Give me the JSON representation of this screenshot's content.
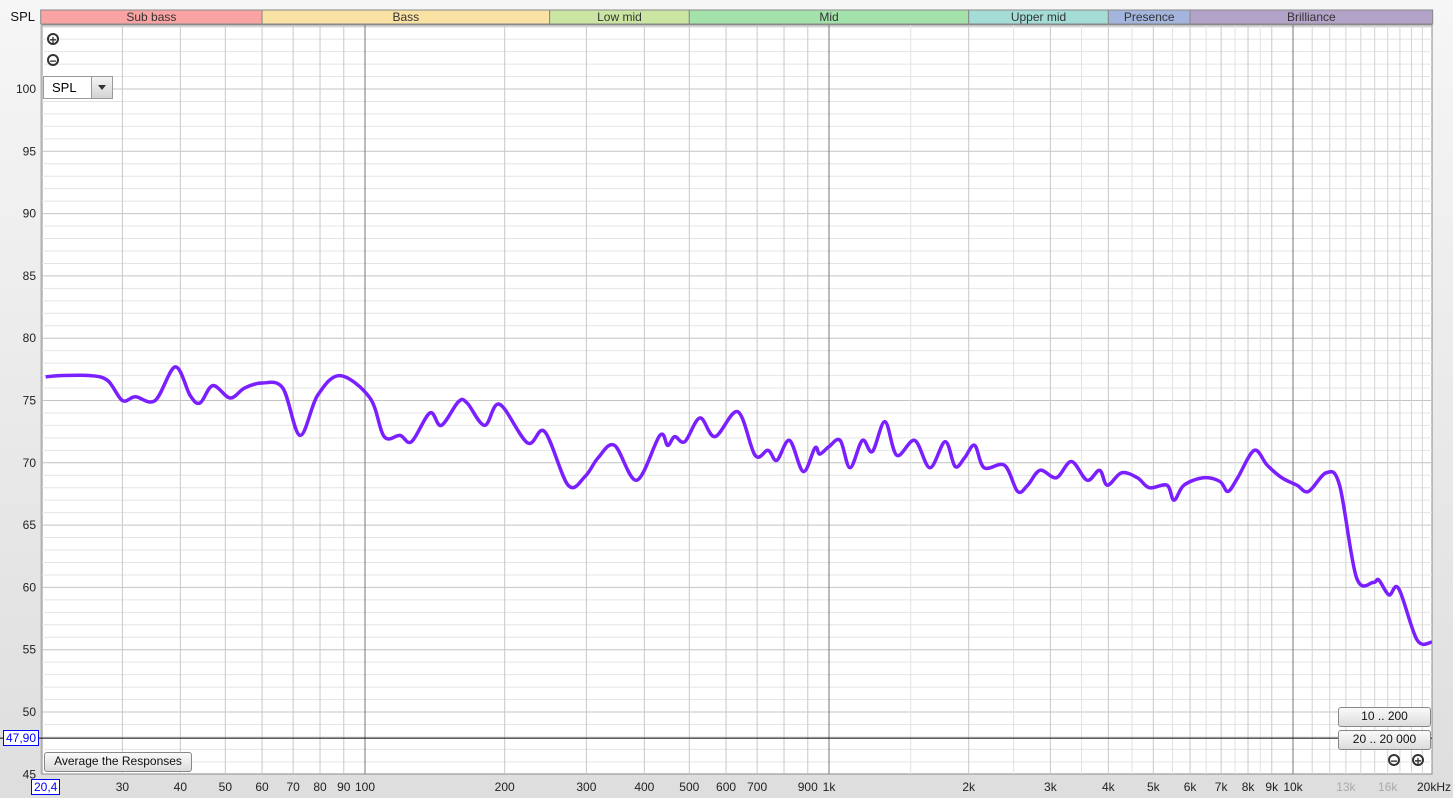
{
  "chart_data": {
    "type": "line",
    "ylabel": "SPL",
    "xunit": "kHz",
    "xscale": "log",
    "xlim": [
      20,
      20000
    ],
    "ylim": [
      45,
      105
    ],
    "grid": true,
    "line_color": "#7b1fff",
    "y_ticks": [
      45,
      50,
      55,
      60,
      65,
      70,
      75,
      80,
      85,
      90,
      95,
      100
    ],
    "x_ticks": [
      {
        "v": 30,
        "label": "30"
      },
      {
        "v": 40,
        "label": "40"
      },
      {
        "v": 50,
        "label": "50"
      },
      {
        "v": 60,
        "label": "60"
      },
      {
        "v": 70,
        "label": "70"
      },
      {
        "v": 80,
        "label": "80"
      },
      {
        "v": 90,
        "label": "90"
      },
      {
        "v": 100,
        "label": "100"
      },
      {
        "v": 200,
        "label": "200"
      },
      {
        "v": 300,
        "label": "300"
      },
      {
        "v": 400,
        "label": "400"
      },
      {
        "v": 500,
        "label": "500"
      },
      {
        "v": 600,
        "label": "600"
      },
      {
        "v": 700,
        "label": "700"
      },
      {
        "v": 900,
        "label": "900"
      },
      {
        "v": 1000,
        "label": "1k"
      },
      {
        "v": 2000,
        "label": "2k"
      },
      {
        "v": 3000,
        "label": "3k"
      },
      {
        "v": 4000,
        "label": "4k"
      },
      {
        "v": 5000,
        "label": "5k"
      },
      {
        "v": 6000,
        "label": "6k"
      },
      {
        "v": 7000,
        "label": "7k"
      },
      {
        "v": 8000,
        "label": "8k"
      },
      {
        "v": 9000,
        "label": "9k"
      },
      {
        "v": 10000,
        "label": "10k"
      },
      {
        "v": 13000,
        "label": "13k",
        "dim": true
      },
      {
        "v": 16000,
        "label": "16k",
        "dim": true
      },
      {
        "v": 20000,
        "label": "20kHz"
      }
    ],
    "bands": [
      {
        "label": "Sub bass",
        "from": 20,
        "to": 60,
        "color": "#f9a3a3"
      },
      {
        "label": "Bass",
        "from": 60,
        "to": 250,
        "color": "#f9e2a3"
      },
      {
        "label": "Low mid",
        "from": 250,
        "to": 500,
        "color": "#cbe6a3"
      },
      {
        "label": "Mid",
        "from": 500,
        "to": 2000,
        "color": "#a3e2aa"
      },
      {
        "label": "Upper mid",
        "from": 2000,
        "to": 4000,
        "color": "#a3ddd6"
      },
      {
        "label": "Presence",
        "from": 4000,
        "to": 6000,
        "color": "#a3b5dd"
      },
      {
        "label": "Brilliance",
        "from": 6000,
        "to": 20000,
        "color": "#b3a3c8"
      }
    ],
    "cursor": {
      "freq_label": "20,4",
      "spl_label": "47,90",
      "spl": 47.9
    },
    "points": [
      [
        20.5,
        76.9
      ],
      [
        22,
        77.0
      ],
      [
        25.6,
        77.0
      ],
      [
        27.9,
        76.6
      ],
      [
        30,
        75.0
      ],
      [
        32,
        75.3
      ],
      [
        35.3,
        75.0
      ],
      [
        39,
        77.7
      ],
      [
        42,
        75.4
      ],
      [
        44.1,
        74.8
      ],
      [
        47,
        76.2
      ],
      [
        51.2,
        75.2
      ],
      [
        55,
        76.0
      ],
      [
        60,
        76.4
      ],
      [
        66.5,
        76.0
      ],
      [
        72.4,
        72.2
      ],
      [
        79,
        75.4
      ],
      [
        88.3,
        77.0
      ],
      [
        102.5,
        75.2
      ],
      [
        110,
        72.1
      ],
      [
        119,
        72.2
      ],
      [
        126,
        71.7
      ],
      [
        138,
        74.0
      ],
      [
        146,
        73.0
      ],
      [
        159,
        74.9
      ],
      [
        166,
        74.8
      ],
      [
        181,
        73.0
      ],
      [
        195,
        74.7
      ],
      [
        224,
        71.6
      ],
      [
        244,
        72.5
      ],
      [
        274,
        68.2
      ],
      [
        298,
        68.9
      ],
      [
        318,
        70.4
      ],
      [
        345,
        71.4
      ],
      [
        385,
        68.6
      ],
      [
        432,
        72.2
      ],
      [
        449,
        71.4
      ],
      [
        465,
        72.1
      ],
      [
        489,
        71.7
      ],
      [
        527,
        73.6
      ],
      [
        568,
        72.1
      ],
      [
        636,
        74.1
      ],
      [
        693,
        70.6
      ],
      [
        739,
        71.0
      ],
      [
        772,
        70.2
      ],
      [
        822,
        71.8
      ],
      [
        880,
        69.3
      ],
      [
        933,
        71.2
      ],
      [
        955,
        70.7
      ],
      [
        1000,
        71.3
      ],
      [
        1057,
        71.8
      ],
      [
        1110,
        69.6
      ],
      [
        1180,
        71.8
      ],
      [
        1240,
        70.9
      ],
      [
        1320,
        73.3
      ],
      [
        1400,
        70.6
      ],
      [
        1530,
        71.8
      ],
      [
        1650,
        69.6
      ],
      [
        1780,
        71.7
      ],
      [
        1870,
        69.7
      ],
      [
        1960,
        70.4
      ],
      [
        2060,
        71.4
      ],
      [
        2160,
        69.6
      ],
      [
        2390,
        69.8
      ],
      [
        2550,
        67.7
      ],
      [
        2680,
        68.2
      ],
      [
        2850,
        69.4
      ],
      [
        3090,
        68.8
      ],
      [
        3330,
        70.1
      ],
      [
        3600,
        68.6
      ],
      [
        3830,
        69.4
      ],
      [
        3980,
        68.2
      ],
      [
        4270,
        69.2
      ],
      [
        4620,
        68.8
      ],
      [
        4900,
        68.0
      ],
      [
        5350,
        68.2
      ],
      [
        5540,
        67.0
      ],
      [
        5820,
        68.2
      ],
      [
        6410,
        68.8
      ],
      [
        6960,
        68.5
      ],
      [
        7240,
        67.7
      ],
      [
        7600,
        68.8
      ],
      [
        8250,
        71.0
      ],
      [
        8800,
        69.8
      ],
      [
        9460,
        68.8
      ],
      [
        10200,
        68.2
      ],
      [
        10800,
        67.7
      ],
      [
        11800,
        69.2
      ],
      [
        12600,
        68.2
      ],
      [
        13700,
        60.8
      ],
      [
        14900,
        60.4
      ],
      [
        15300,
        60.6
      ],
      [
        16100,
        59.4
      ],
      [
        16900,
        59.9
      ],
      [
        18500,
        55.8
      ],
      [
        19900,
        55.6
      ]
    ]
  },
  "controls": {
    "measure_select": "SPL",
    "average_button": "Average the Responses",
    "range_10_200": "10 .. 200",
    "range_20_20000": "20 .. 20 000",
    "zoom_in": "+",
    "zoom_out": "−"
  }
}
